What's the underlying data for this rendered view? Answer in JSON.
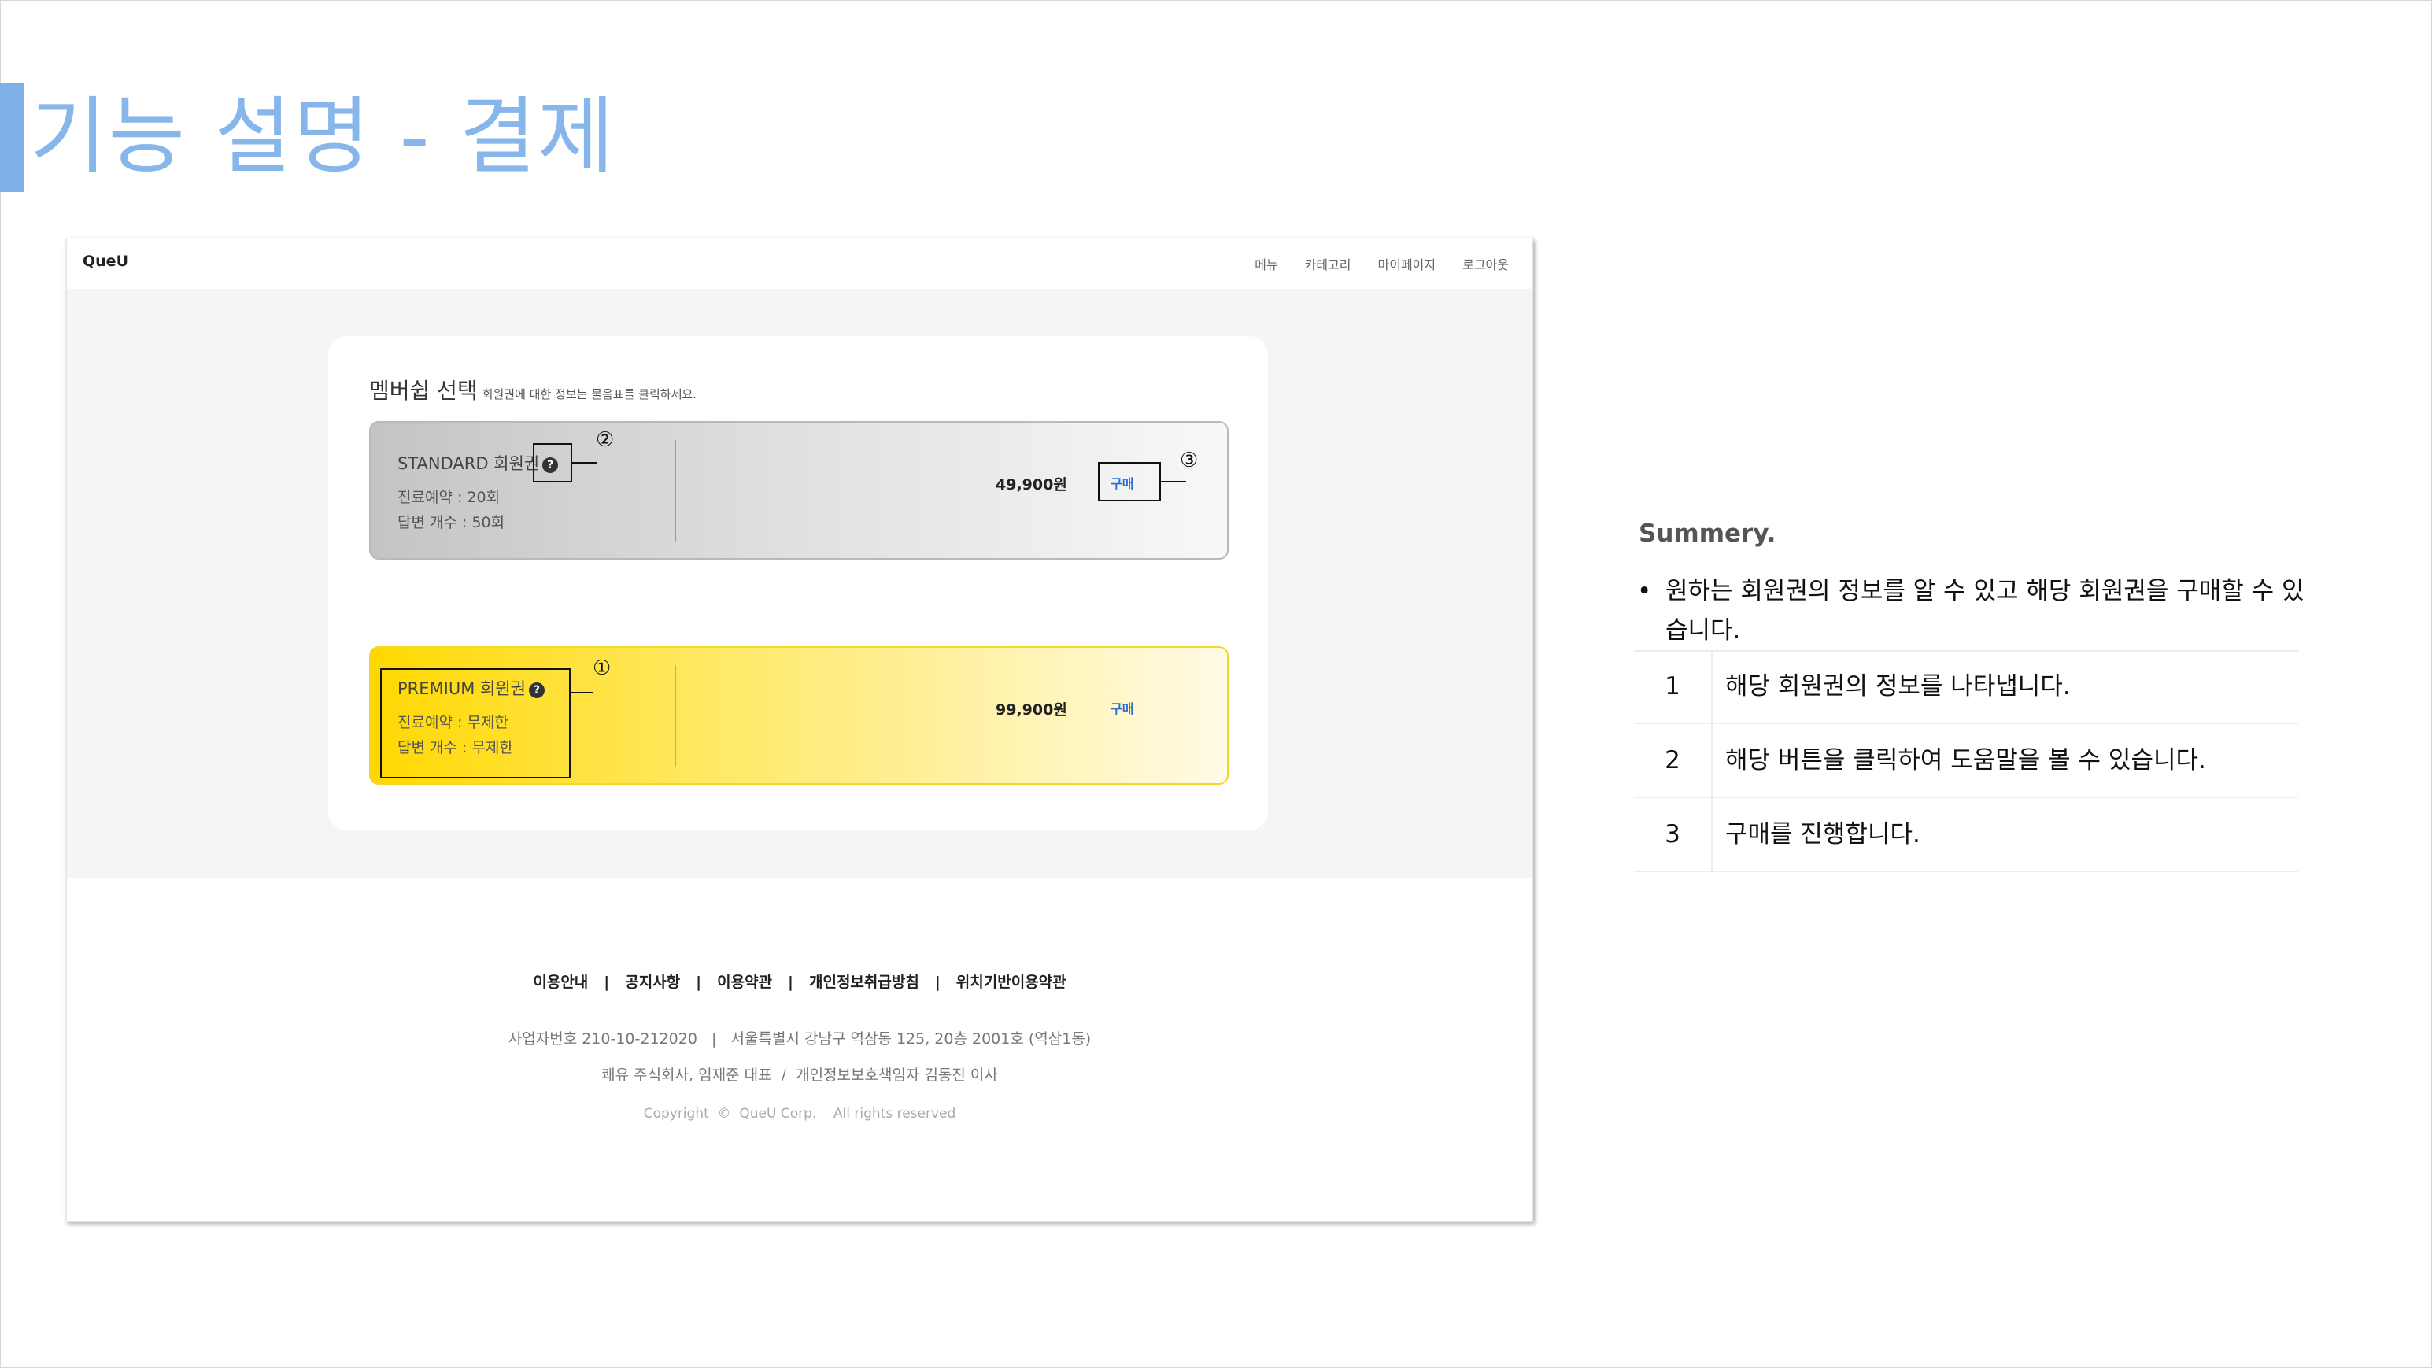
{
  "slide": {
    "title": "기능 설명 - 결제"
  },
  "app": {
    "brand": "QueU",
    "nav": [
      "메뉴",
      "카테고리",
      "마이페이지",
      "로그아웃"
    ],
    "membership": {
      "heading": "멤버쉽 선택",
      "subheading": "회원권에 대한 정보는 물음표를 클릭하세요.",
      "plans": [
        {
          "name": "STANDARD 회원권",
          "line1": "진료예약 : 20회",
          "line2": "답변 개수 : 50회",
          "price": "49,900원",
          "buy": "구매"
        },
        {
          "name": "PREMIUM 회원권",
          "line1": "진료예약 : 무제한",
          "line2": "답변 개수 : 무제한",
          "price": "99,900원",
          "buy": "구매"
        }
      ]
    },
    "help_glyph": "?",
    "footer": {
      "links": [
        "이용안내",
        "공지사항",
        "이용약관",
        "개인정보취급방침",
        "위치기반이용약관"
      ],
      "separator": "|",
      "biz": "사업자번호 210-10-212020   |   서울특별시 강남구 역삼동 125, 20층 2001호 (역삼1동)",
      "company": "쾌유 주식회사, 임재준 대표  /  개인정보보호책임자 김동진 이사",
      "copyright": "Copyright  ©  QueU Corp.    All rights reserved"
    }
  },
  "annotations": {
    "n1": "①",
    "n2": "②",
    "n3": "③"
  },
  "summary": {
    "title": "Summery.",
    "bullet_mark": "•",
    "bullet": "원하는 회원권의 정보를 알 수 있고 해당 회원권을 구매할 수 있습니다.",
    "rows": [
      {
        "num": "1",
        "desc": "해당 회원권의 정보를 나타냅니다."
      },
      {
        "num": "2",
        "desc": "해당 버튼을 클릭하여 도움말을 볼 수 있습니다."
      },
      {
        "num": "3",
        "desc": "구매를 진행합니다."
      }
    ]
  }
}
